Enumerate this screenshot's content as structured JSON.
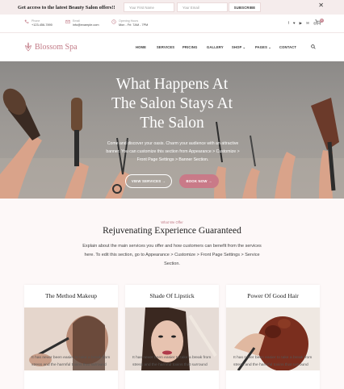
{
  "promo": {
    "text": "Get access to the latest Beauty Salon offers!!",
    "first_name_placeholder": "Your First Name",
    "email_placeholder": "Your Email",
    "subscribe_label": "SUBSCRIBE",
    "close_glyph": "✕"
  },
  "contact": {
    "phone_label": "Phone",
    "phone_value": "+123-456-7890",
    "email_label": "Email",
    "email_value": "info@example.com",
    "hours_label": "Opening Hours",
    "hours_value": "Mon - Fri: 7AM - 7PM",
    "socials": [
      "f",
      "♥",
      "▶",
      "✉",
      "◎"
    ],
    "cart_count": "0"
  },
  "nav": {
    "logo_text": "Blossom Spa",
    "items": [
      "HOME",
      "SERVICES",
      "PRICING",
      "GALLERY",
      "SHOP",
      "PAGES",
      "CONTACT"
    ]
  },
  "hero": {
    "title_line1": "What Happens At",
    "title_line2": "The Salon Stays At",
    "title_line3": "The Salon",
    "description": "Come and discover your oasis. Charm your audience with an attractive banner. You can customize this section from Appearance > Customize > Front Page Settings > Banner Section.",
    "btn_services": "VIEW SERVICES →",
    "btn_book": "BOOK NOW →"
  },
  "services": {
    "kicker": "What We Offer",
    "title": "Rejuvenating Experience Guaranteed",
    "description": "Explain about the main services you offer and how customers can benefit from the services here. To edit this section, go to Appearance > Customize > Front Page Settings > Service Section.",
    "cards": [
      {
        "title": "The Method Makeup",
        "text": "It has never been easier to take a break from stress and the harmful toxins that surround"
      },
      {
        "title": "Shade Of Lipstick",
        "text": "It has never been easier to take a break from stress and the harmful toxins that surround"
      },
      {
        "title": "Power Of Good Hair",
        "text": "It has never been easier to take a break from stress and the harmful toxins that surround"
      }
    ]
  },
  "colors": {
    "accent": "#c27b87",
    "button_pink": "#c97a88",
    "promo_bg": "#f5ecec"
  }
}
